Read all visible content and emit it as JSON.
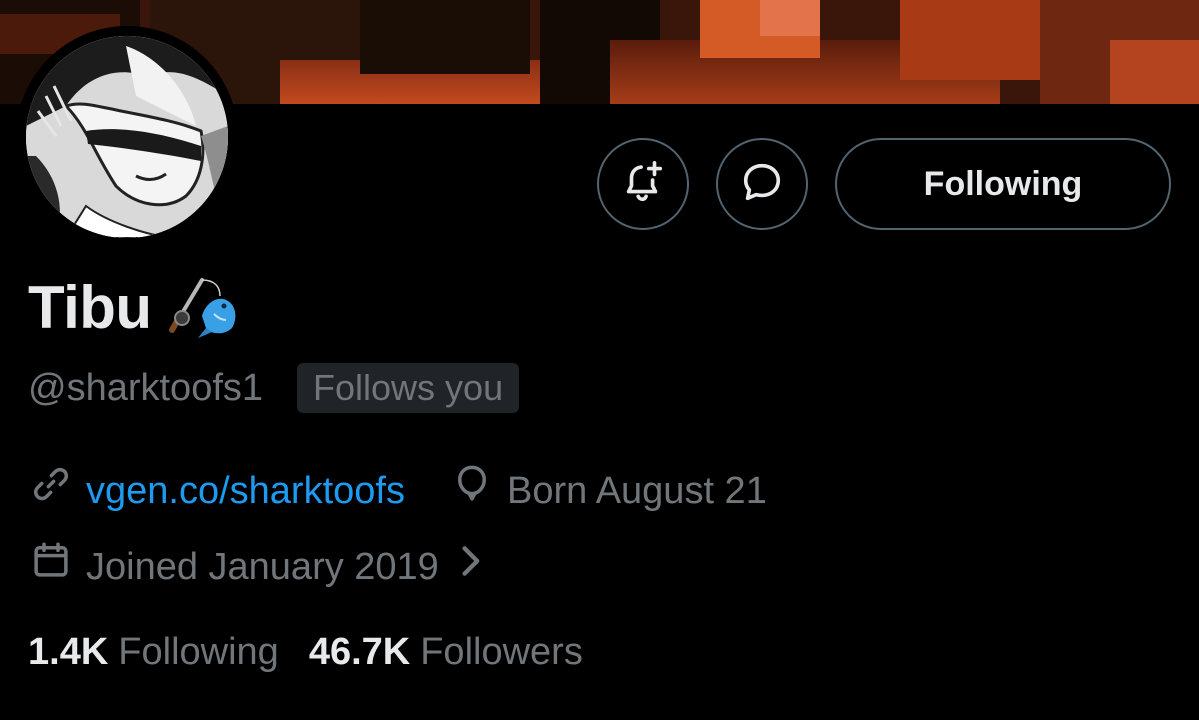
{
  "profile": {
    "display_name": "Tibu",
    "handle": "@sharktoofs1",
    "follows_you": "Follows you",
    "website": "vgen.co/sharktoofs",
    "birthday": "Born August 21",
    "joined": "Joined January 2019",
    "following_count": "1.4K",
    "following_label": "Following",
    "followers_count": "46.7K",
    "followers_label": "Followers"
  },
  "actions": {
    "follow_button_label": "Following",
    "notify_icon": "bell-plus-icon",
    "message_icon": "speech-bubble-icon"
  },
  "icons": {
    "name_emoji": [
      "fishing-pole-icon",
      "fish-icon"
    ],
    "link_icon": "link-icon",
    "birthday_icon": "balloon-icon",
    "joined_icon": "calendar-icon",
    "joined_chevron": "chevron-right-icon"
  },
  "colors": {
    "background": "#000000",
    "primary_text": "#e7e9ea",
    "secondary_text": "#71767b",
    "link": "#1d9bf0",
    "button_border": "#536471",
    "badge_bg": "#202327"
  }
}
